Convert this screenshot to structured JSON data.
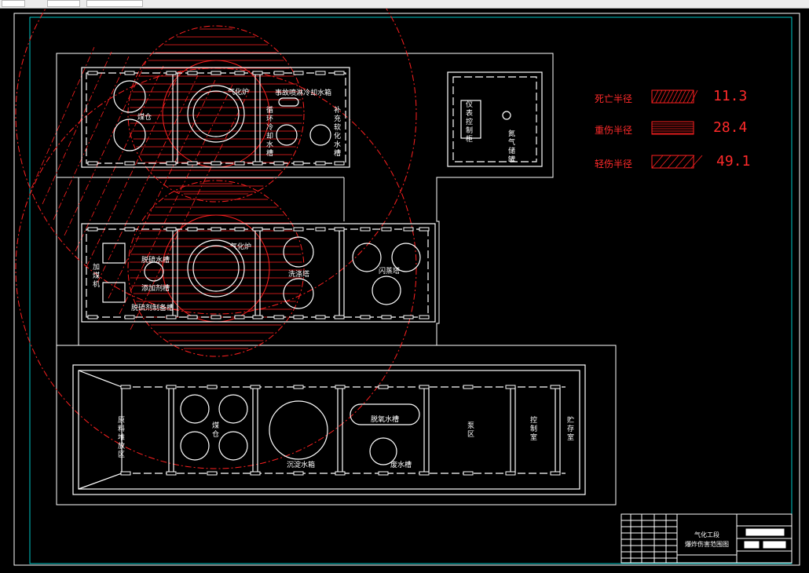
{
  "legend": {
    "items": [
      {
        "label": "死亡半径",
        "value": "11.3",
        "hatch": "dense"
      },
      {
        "label": "重伤半径",
        "value": "28.4",
        "hatch": "horizontal"
      },
      {
        "label": "轻伤半径",
        "value": "49.1",
        "hatch": "diagonal"
      }
    ]
  },
  "rooms": {
    "top": {
      "coal_bin": "煤仓",
      "gasifier": "气化炉",
      "washing_cooler": "事故喷淋冷却水箱",
      "cooling_water_tank": "循环冷却水槽",
      "soft_water_tank": "补充软化水槽",
      "control_box": "仪表控制柜",
      "nitrogen_tank": "氮气储罐"
    },
    "middle": {
      "coal_feeder": "加煤机",
      "desulfur_tank": "脱硫水槽",
      "gasifier": "气化炉",
      "additive_tank": "添加剂槽",
      "reagent_tank": "脱硫剂制备槽",
      "scrubber": "洗涤塔",
      "flash_tower": "闪蒸塔"
    },
    "bottom": {
      "material_area": "原料堆放区",
      "coal_storage": "煤仓",
      "settling_tank": "沉淀水箱",
      "desulfur_tank": "脱氧水槽",
      "waste_tank": "废水槽",
      "pump_area": "泵区",
      "control_room": "控制室",
      "storage_room": "贮存室"
    }
  },
  "title_block": {
    "title_line1": "气化工段",
    "title_line2": "爆炸伤害范围图"
  },
  "colors": {
    "background": "#000000",
    "wall": "#ffffff",
    "hazard": "#ff2020",
    "border": "#00c8c8"
  }
}
